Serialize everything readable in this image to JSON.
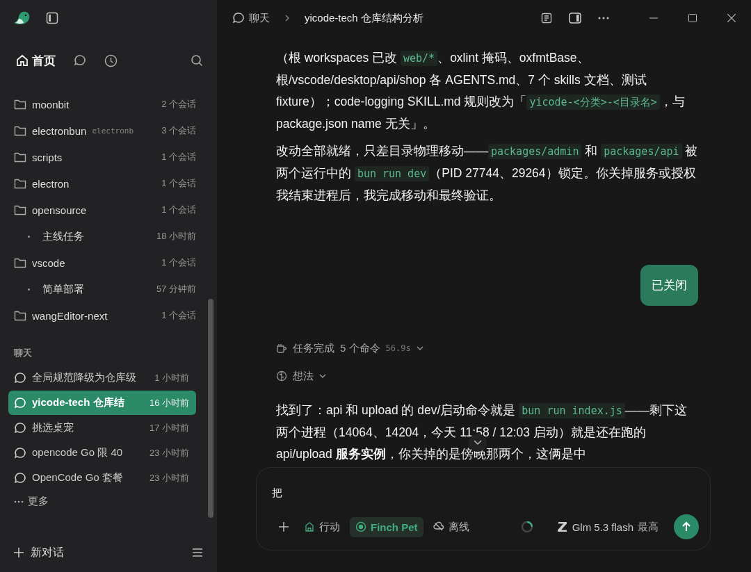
{
  "window": {
    "breadcrumb": "聊天",
    "title": "yicode-tech 仓库结构分析"
  },
  "nav": {
    "home": "首页"
  },
  "projects": [
    {
      "name": "moonbit",
      "count": "2 个会话"
    },
    {
      "name": "electronbun",
      "hint": "electronb",
      "count": "3 个会话"
    },
    {
      "name": "scripts",
      "count": "1 个会话"
    },
    {
      "name": "electron",
      "count": "1 个会话"
    },
    {
      "name": "opensource",
      "count": "1 个会话",
      "children": [
        {
          "label": "主线任务",
          "time": "18 小时前"
        }
      ]
    },
    {
      "name": "vscode",
      "count": "1 个会话",
      "children": [
        {
          "label": "简单部署",
          "time": "57 分钟前"
        }
      ]
    },
    {
      "name": "wangEditor-next",
      "count": "1 个会话"
    }
  ],
  "chats_heading": "聊天",
  "chats": [
    {
      "label": "全局规范降级为仓库级",
      "time": "1 小时前",
      "selected": false
    },
    {
      "label": "yicode-tech 仓库结",
      "time": "16 小时前",
      "selected": true
    },
    {
      "label": "挑选桌宠",
      "time": "17 小时前",
      "selected": false
    },
    {
      "label": "opencode Go 限 40",
      "time": "23 小时前",
      "selected": false
    },
    {
      "label": "OpenCode Go 套餐",
      "time": "23 小时前",
      "selected": false
    }
  ],
  "more": "更多",
  "new_chat": "新对话",
  "messages": [
    {
      "kind": "assistant",
      "paragraphs": [
        [
          {
            "kind": "text",
            "text": "（根 workspaces 已改 "
          },
          {
            "kind": "code",
            "text": "web/*"
          },
          {
            "kind": "text",
            "text": "、oxlint 掩码、oxfmtBase、根/vscode/desktop/api/shop 各 AGENTS.md、7 个 skills 文档、测试 fixture）；code-logging SKILL.md 规则改为「"
          },
          {
            "kind": "code",
            "text": "yicode-<分类>-<目录名>"
          },
          {
            "kind": "text",
            "text": "，与 package.json name 无关」。"
          }
        ],
        [
          {
            "kind": "text",
            "text": "改动全部就绪，只差目录物理移动——"
          },
          {
            "kind": "code",
            "text": "packages/admin"
          },
          {
            "kind": "text",
            "text": " 和 "
          },
          {
            "kind": "code",
            "text": "packages/api"
          },
          {
            "kind": "text",
            "text": " 被两个运行中的 "
          },
          {
            "kind": "code",
            "text": "bun run dev"
          },
          {
            "kind": "text",
            "text": "（PID 27744、29264）锁定。你关掉服务或授权我结束进程后，我完成移动和最终验证。"
          }
        ]
      ]
    },
    {
      "kind": "user",
      "text": "已关闭"
    },
    {
      "kind": "task",
      "label": "任务完成",
      "detail": "5 个命令",
      "duration": "56.9s"
    },
    {
      "kind": "thought",
      "label": "想法"
    },
    {
      "kind": "assistant",
      "paragraphs": [
        [
          {
            "kind": "text",
            "text": "找到了：api 和 upload 的 dev/启动命令就是 "
          },
          {
            "kind": "code",
            "text": "bun run index.js"
          },
          {
            "kind": "text",
            "text": "——剩下这两个进程（14064、14204，今天 11:58 / 12:03 启动）就是还在跑的 api/upload **服务实例**，你关掉的是傍晚那两个，这俩是中"
          }
        ]
      ]
    }
  ],
  "composer": {
    "value": "把",
    "tools": [
      {
        "kind": "action",
        "label": "行动",
        "selected": false
      },
      {
        "kind": "pet",
        "label": "Finch Pet",
        "selected": true
      },
      {
        "kind": "offline",
        "label": "离线",
        "selected": false
      }
    ],
    "model": "Glm 5.3 flash",
    "effort": "最高"
  }
}
